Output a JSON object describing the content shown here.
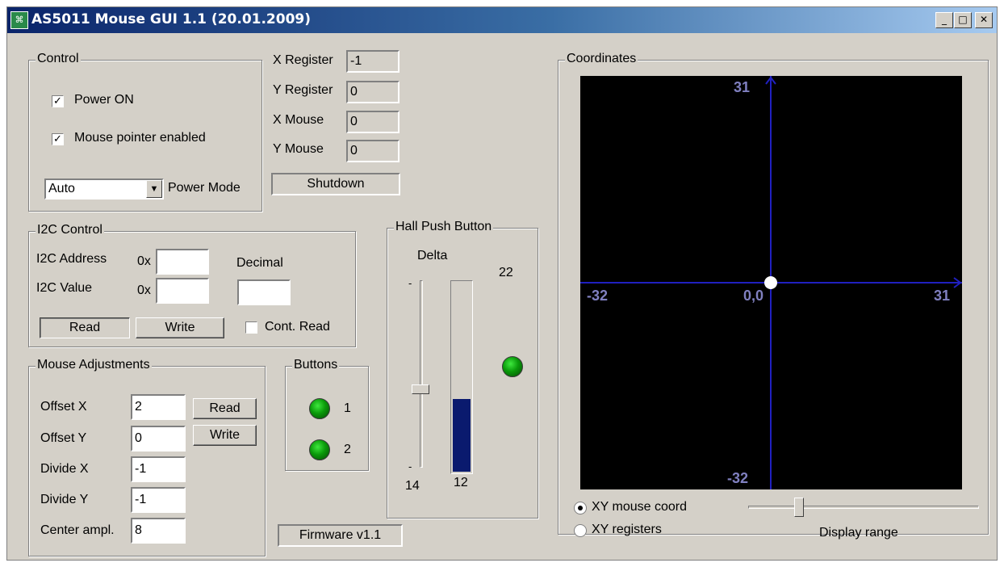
{
  "window": {
    "title": "AS5011 Mouse GUI 1.1 (20.01.2009)",
    "icon": "app-icon",
    "controls": [
      "minimize-icon",
      "maximize-icon",
      "close-icon"
    ]
  },
  "control": {
    "title": "Control",
    "power_on": {
      "label": "Power ON",
      "checked": true
    },
    "mouse_pointer": {
      "label": "Mouse pointer enabled",
      "checked": true
    },
    "power_mode_value": "Auto",
    "power_mode_label": "Power Mode"
  },
  "registers": {
    "x_register_label": "X Register",
    "x_register_value": "-1",
    "y_register_label": "Y Register",
    "y_register_value": "0",
    "x_mouse_label": "X Mouse",
    "x_mouse_value": "0",
    "y_mouse_label": "Y Mouse",
    "y_mouse_value": "0",
    "status_label": "Shutdown"
  },
  "i2c": {
    "title": "I2C Control",
    "address_label": "I2C Address",
    "address_prefix": "0x",
    "address_value": "",
    "decimal_label": "Decimal",
    "value_label": "I2C Value",
    "value_prefix": "0x",
    "value_value": "",
    "decimal_value": "",
    "read_label": "Read",
    "write_label": "Write",
    "cont_read_label": "Cont. Read",
    "cont_read_checked": false
  },
  "mouse_adjustments": {
    "title": "Mouse Adjustments",
    "offset_x_label": "Offset X",
    "offset_x_value": "2",
    "offset_y_label": "Offset Y",
    "offset_y_value": "0",
    "divide_x_label": "Divide X",
    "divide_x_value": "-1",
    "divide_y_label": "Divide Y",
    "divide_y_value": "-1",
    "center_ampl_label": "Center ampl.",
    "center_ampl_value": "8",
    "read_label": "Read",
    "write_label": "Write"
  },
  "buttons": {
    "title": "Buttons",
    "led1_label": "1",
    "led2_label": "2",
    "led_color": "#0a9a0a"
  },
  "hall": {
    "title": "Hall Push Button",
    "delta_label": "Delta",
    "delta_value": "22",
    "slider_min_label": "14",
    "bar_value_label": "12",
    "bar_fill_fraction": 0.38,
    "slider_position_fraction": 0.58,
    "bar_color": "#0a1a6e"
  },
  "firmware": {
    "label": "Firmware v1.1"
  },
  "coordinates": {
    "title": "Coordinates",
    "y_max_label": "31",
    "y_min_label": "-32",
    "x_min_label": "-32",
    "x_max_label": "31",
    "origin_label": "0,0",
    "point_x": 0,
    "point_y": 0,
    "axis_color": "#2020c0",
    "xy_mouse_label": "XY mouse coord",
    "xy_mouse_selected": true,
    "xy_registers_label": "XY registers",
    "display_range_label": "Display range",
    "display_range_fraction": 0.22
  }
}
